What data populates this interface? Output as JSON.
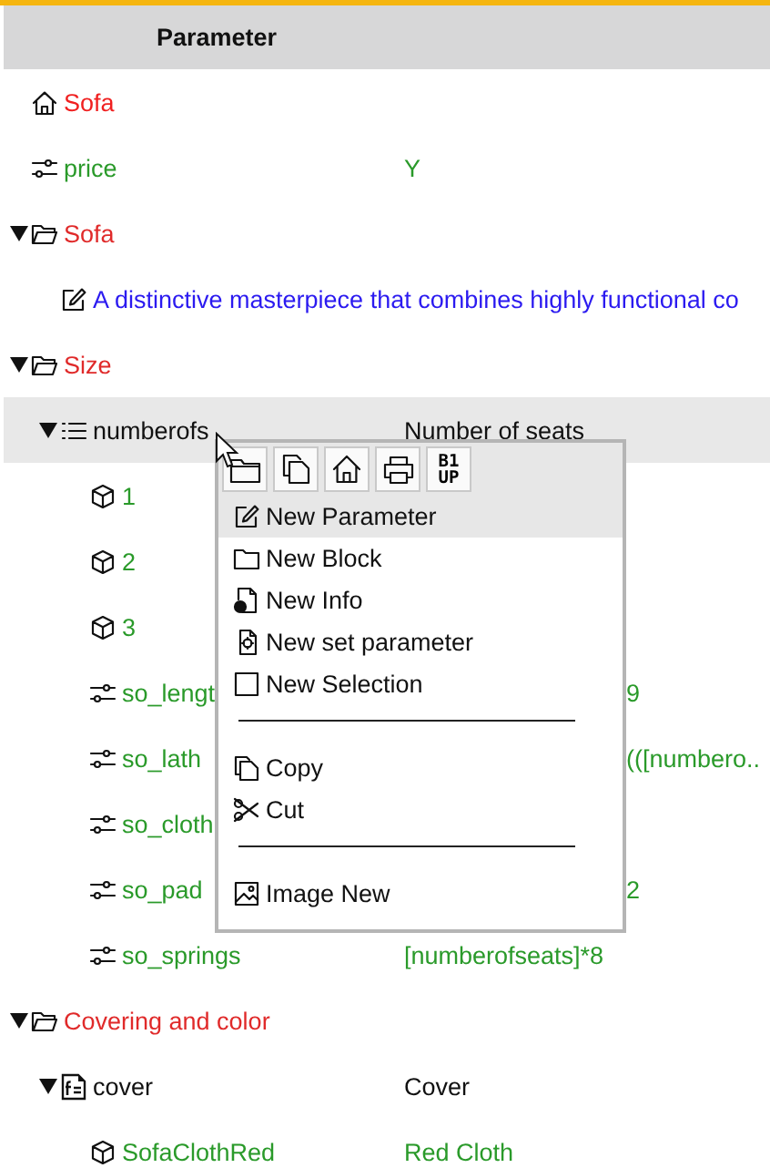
{
  "header": {
    "title": "Parameter"
  },
  "tree": [
    {
      "kind": "home",
      "name": "Sofa",
      "selected": false
    },
    {
      "kind": "param",
      "name": "price",
      "value": "Y",
      "selected": false
    },
    {
      "kind": "folder",
      "name": "Sofa",
      "expanded": true,
      "selected": false,
      "children": [
        {
          "kind": "info",
          "name": "A distinctive masterpiece that combines highly functional co",
          "selected": false
        }
      ]
    },
    {
      "kind": "folder",
      "name": "Size",
      "expanded": true,
      "selected": false,
      "children": [
        {
          "kind": "list",
          "name": "numberofs",
          "value": "Number of seats",
          "expanded": true,
          "selected": true,
          "children": [
            {
              "kind": "option",
              "name": "1",
              "selected": false
            },
            {
              "kind": "option",
              "name": "2",
              "selected": false
            },
            {
              "kind": "option",
              "name": "3",
              "selected": false
            },
            {
              "kind": "param",
              "name": "so_lengt",
              "value": "9",
              "selected": false
            },
            {
              "kind": "param",
              "name": "so_lath",
              "value": "(([numbero..",
              "selected": false
            },
            {
              "kind": "param",
              "name": "so_cloth",
              "selected": false
            },
            {
              "kind": "param",
              "name": "so_pad",
              "value": "2",
              "selected": false
            },
            {
              "kind": "param",
              "name": "so_springs",
              "value": "[numberofseats]*8",
              "selected": false
            }
          ]
        }
      ]
    },
    {
      "kind": "folder",
      "name": "Covering and color",
      "expanded": true,
      "selected": false,
      "children": [
        {
          "kind": "file",
          "name": "cover",
          "value": "Cover",
          "expanded": true,
          "selected": false,
          "children": [
            {
              "kind": "option",
              "name": "SofaClothRed",
              "value": "Red Cloth",
              "selected": false
            }
          ]
        }
      ]
    }
  ],
  "context_menu": {
    "toolbar": [
      {
        "kind": "folder"
      },
      {
        "kind": "copy"
      },
      {
        "kind": "home"
      },
      {
        "kind": "print"
      },
      {
        "kind": "text",
        "lines": [
          "B1",
          "UP"
        ]
      }
    ],
    "items": [
      {
        "kind": "item",
        "label": "New Parameter",
        "selected": true
      },
      {
        "kind": "item",
        "label": "New Block",
        "selected": false
      },
      {
        "kind": "item",
        "label": "New Info",
        "selected": false
      },
      {
        "kind": "item",
        "label": "New set parameter",
        "selected": false
      },
      {
        "kind": "item",
        "label": "New Selection",
        "selected": false
      },
      {
        "kind": "separator"
      },
      {
        "kind": "item",
        "label": "Copy",
        "selected": false
      },
      {
        "kind": "item",
        "label": "Cut",
        "selected": false
      },
      {
        "kind": "separator"
      },
      {
        "kind": "item",
        "label": "Image New",
        "selected": false
      }
    ]
  }
}
